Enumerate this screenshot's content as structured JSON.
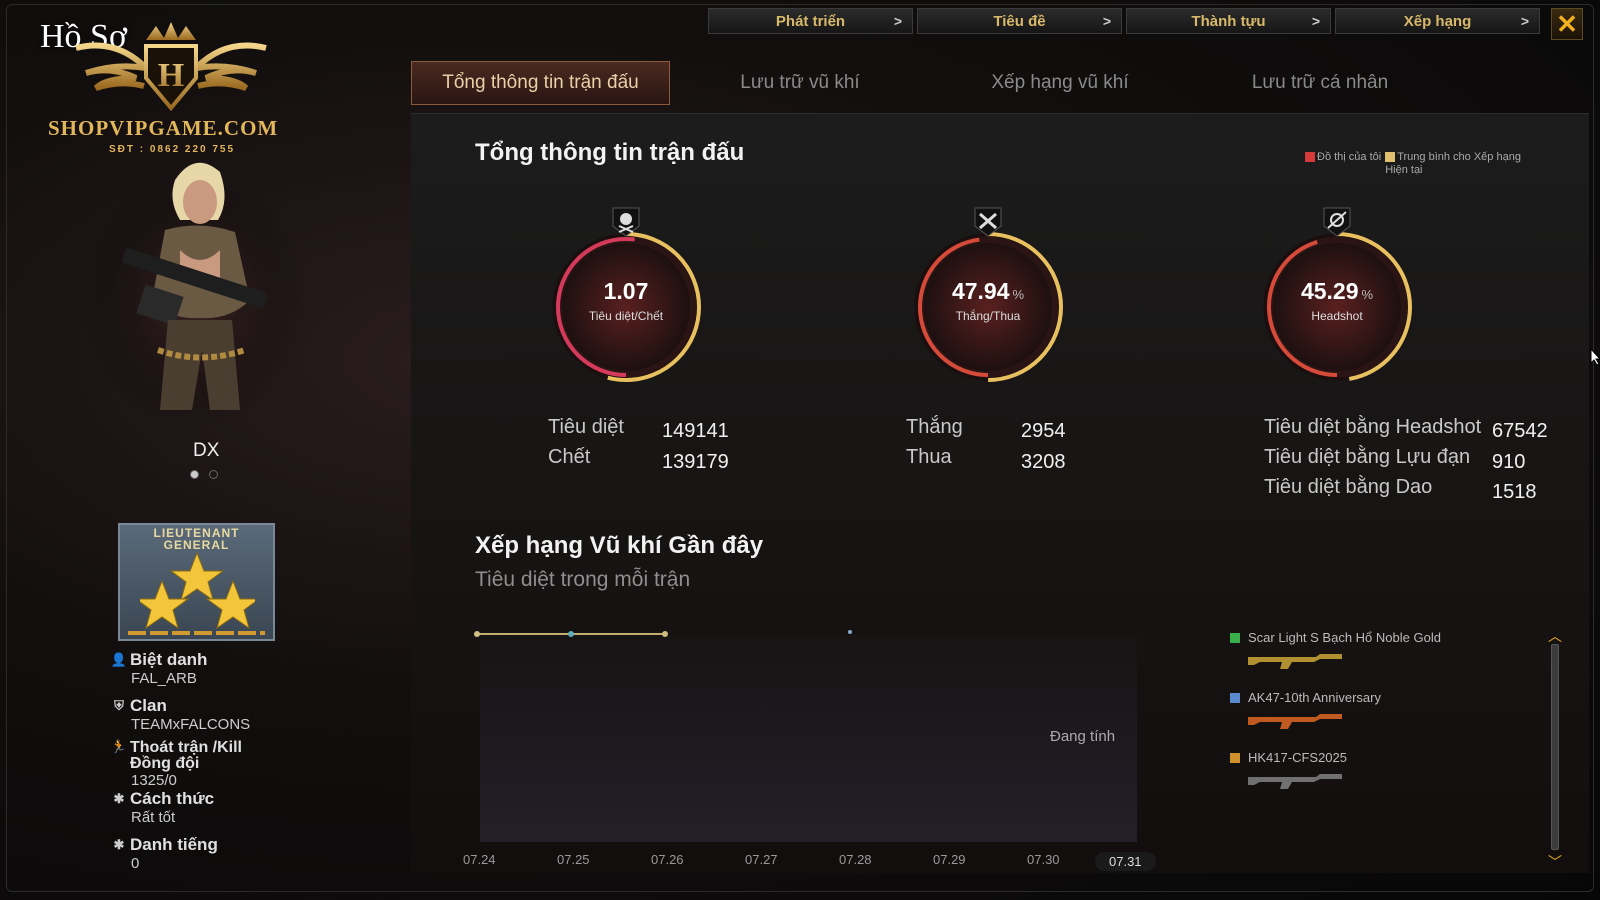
{
  "window": {
    "title": "Hồ Sơ",
    "close_icon": "close-icon"
  },
  "brand": {
    "site": "SHOPVIPGAME.COM",
    "phone": "SĐT : 0862 220 755",
    "crest_letter": "H"
  },
  "top_nav": [
    {
      "label": "Phát triển"
    },
    {
      "label": "Tiêu đề"
    },
    {
      "label": "Thành tựu"
    },
    {
      "label": "Xếp hạng"
    }
  ],
  "tabs": [
    {
      "label": "Tổng thông tin trận đấu",
      "active": true
    },
    {
      "label": "Lưu trữ vũ khí"
    },
    {
      "label": "Xếp hạng vũ khí"
    },
    {
      "label": "Lưu trữ cá nhân"
    }
  ],
  "profile": {
    "character_name": "DX",
    "rank_text": "LIEUTENANT GENERAL",
    "nickname_label": "Biệt danh",
    "nickname": "FAL_ARB",
    "clan_label": "Clan",
    "clan": "TEAMxFALCONS",
    "quit_label": "Thoát trận /Kill Đồng đội",
    "quit_value": "1325/0",
    "manner_label": "Cách thức",
    "manner": "Rất tốt",
    "fame_label": "Danh tiếng",
    "fame": "0"
  },
  "summary": {
    "title": "Tổng thông tin trận đấu",
    "legend_mine": "Đồ thị của tôi",
    "legend_avg": "Trung bình cho Xếp hạng Hiện tại",
    "legend_mine_color": "#d63a3a",
    "legend_avg_color": "#e0c070",
    "rings": [
      {
        "value": "1.07",
        "unit": "",
        "label": "Tiêu diệt/Chết",
        "fraction": 0.52,
        "icon": "skull-crossbones-icon"
      },
      {
        "value": "47.94",
        "unit": "%",
        "label": "Thắng/Thua",
        "fraction": 0.4794,
        "icon": "crossed-guns-icon"
      },
      {
        "value": "45.29",
        "unit": "%",
        "label": "Headshot",
        "fraction": 0.4529,
        "icon": "headshot-icon"
      }
    ],
    "kills_label": "Tiêu diệt",
    "kills": "149141",
    "deaths_label": "Chết",
    "deaths": "139179",
    "wins_label": "Thắng",
    "wins": "2954",
    "losses_label": "Thua",
    "losses": "3208",
    "hs_kills_label": "Tiêu diệt bằng Headshot",
    "hs_kills": "67542",
    "grenade_kills_label": "Tiêu diệt bằng Lựu đạn",
    "grenade_kills": "910",
    "knife_kills_label": "Tiêu diệt bằng Dao",
    "knife_kills": "1518"
  },
  "weapon_chart": {
    "title": "Xếp hạng Vũ khí Gần đây",
    "subtitle": "Tiêu diệt trong mỗi trận",
    "pending": "Đang tính",
    "dates": [
      "07.24",
      "07.25",
      "07.26",
      "07.27",
      "07.28",
      "07.29",
      "07.30",
      "07.31"
    ],
    "selected_date": "07.31",
    "weapons": [
      {
        "name": "Scar Light S Bạch Hổ Noble Gold",
        "color": "#3ab04a"
      },
      {
        "name": "AK47-10th Anniversary",
        "color": "#5a8ad0"
      },
      {
        "name": "HK417-CFS2025",
        "color": "#d0902a"
      }
    ]
  }
}
